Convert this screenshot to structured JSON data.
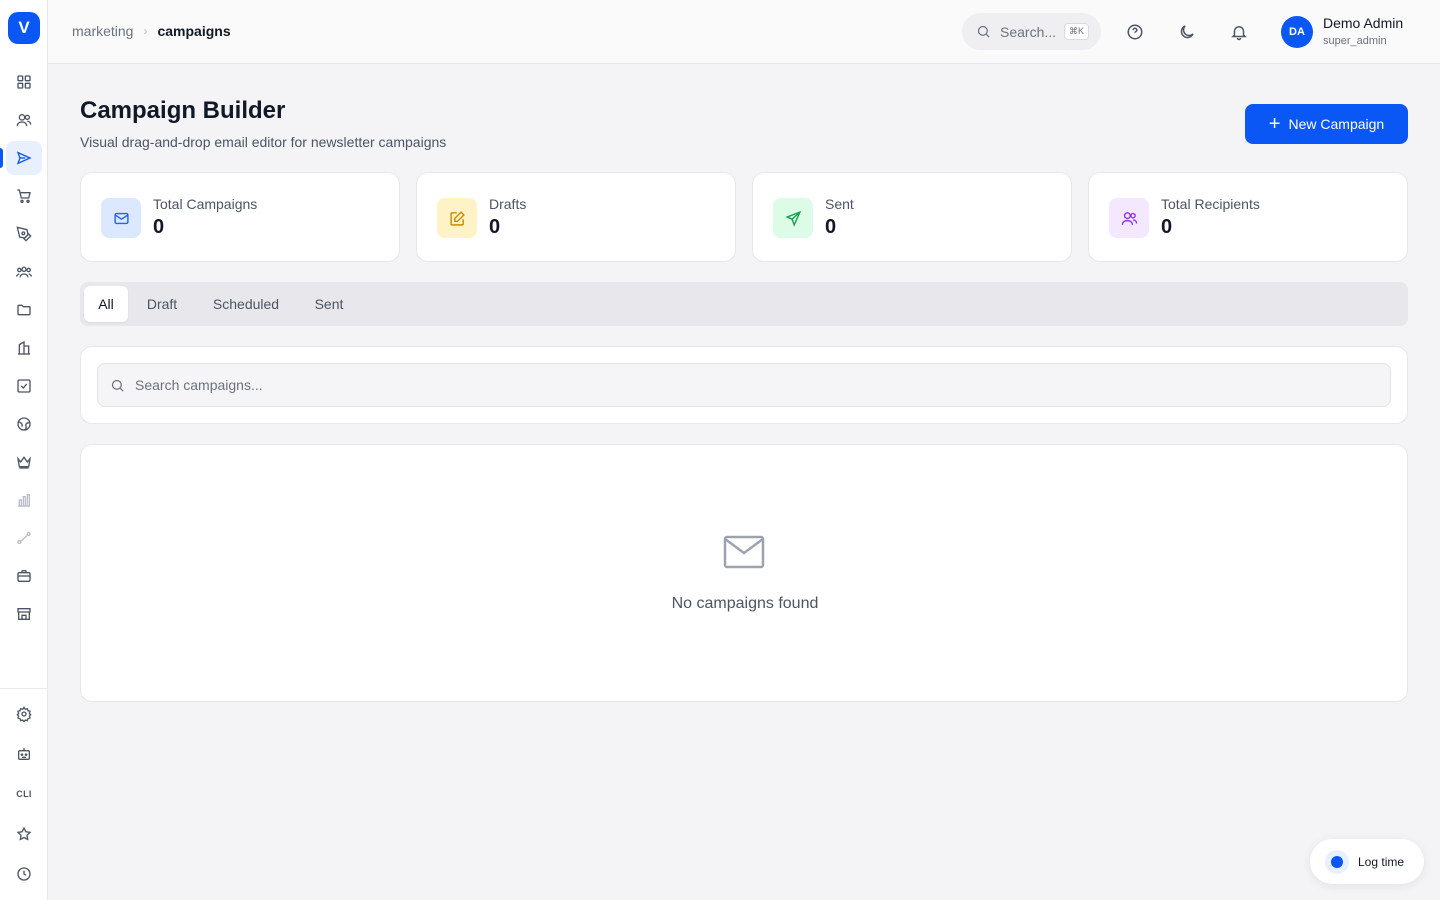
{
  "sidebar": {
    "logo": "V",
    "items": [
      {
        "icon": "grid-icon"
      },
      {
        "icon": "users-icon"
      },
      {
        "icon": "megaphone-icon",
        "active": true
      },
      {
        "icon": "cart-icon"
      },
      {
        "icon": "pen-tool-icon"
      },
      {
        "icon": "team-icon"
      },
      {
        "icon": "folder-icon"
      },
      {
        "icon": "building-icon"
      },
      {
        "icon": "checkbox-icon"
      },
      {
        "icon": "globe-icon"
      },
      {
        "icon": "crown-icon"
      },
      {
        "icon": "bar-chart-icon"
      },
      {
        "icon": "route-icon"
      },
      {
        "icon": "briefcase-icon"
      },
      {
        "icon": "store-icon"
      }
    ],
    "bottom": {
      "settings": "settings-icon",
      "bot": "bot-icon",
      "cli_label": "CLI",
      "star": "star-icon",
      "clock": "clock-icon"
    }
  },
  "header": {
    "breadcrumb": [
      "marketing",
      "campaigns"
    ],
    "search_label": "Search...",
    "search_shortcut": "⌘K",
    "user": {
      "initials": "DA",
      "name": "Demo Admin",
      "role": "super_admin"
    }
  },
  "main": {
    "title": "Campaign Builder",
    "subtitle": "Visual drag-and-drop email editor for newsletter campaigns",
    "new_button_label": "New Campaign",
    "stats": [
      {
        "label": "Total Campaigns",
        "value": "0",
        "icon": "mail-icon",
        "color": "#2563eb",
        "bg": "#dbe8ff"
      },
      {
        "label": "Drafts",
        "value": "0",
        "icon": "edit-icon",
        "color": "#ca8a04",
        "bg": "#fef3c7"
      },
      {
        "label": "Sent",
        "value": "0",
        "icon": "send-icon",
        "color": "#16a34a",
        "bg": "#dcfce7"
      },
      {
        "label": "Total Recipients",
        "value": "0",
        "icon": "users-icon",
        "color": "#9333ea",
        "bg": "#f3e8ff"
      }
    ],
    "tabs": [
      "All",
      "Draft",
      "Scheduled",
      "Sent"
    ],
    "active_tab": "All",
    "search_placeholder": "Search campaigns...",
    "empty_text": "No campaigns found"
  },
  "log_time_label": "Log time",
  "colors": {
    "accent": "#0b57f5"
  }
}
